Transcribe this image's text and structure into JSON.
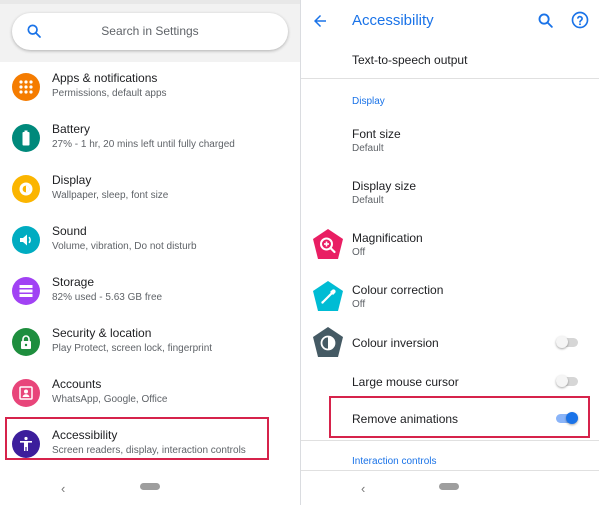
{
  "left_panel": {
    "search_placeholder": "Search in Settings",
    "items": [
      {
        "title": "Apps & notifications",
        "subtitle": "Permissions, default apps",
        "icon": "apps-grid-icon",
        "color": "#f57c00"
      },
      {
        "title": "Battery",
        "subtitle": "27% - 1 hr, 20 mins left until fully charged",
        "icon": "battery-icon",
        "color": "#00897b"
      },
      {
        "title": "Display",
        "subtitle": "Wallpaper, sleep, font size",
        "icon": "brightness-icon",
        "color": "#fbb500"
      },
      {
        "title": "Sound",
        "subtitle": "Volume, vibration, Do not disturb",
        "icon": "volume-icon",
        "color": "#00acc1"
      },
      {
        "title": "Storage",
        "subtitle": "82% used - 5.63 GB free",
        "icon": "storage-icon",
        "color": "#a142f4"
      },
      {
        "title": "Security & location",
        "subtitle": "Play Protect, screen lock, fingerprint",
        "icon": "lock-icon",
        "color": "#1e8e3e"
      },
      {
        "title": "Accounts",
        "subtitle": "WhatsApp, Google, Office",
        "icon": "account-icon",
        "color": "#e8457a"
      },
      {
        "title": "Accessibility",
        "subtitle": "Screen readers, display, interaction controls",
        "icon": "accessibility-icon",
        "color": "#3c1e9c"
      }
    ],
    "nav": {
      "back_glyph": "‹"
    }
  },
  "right_panel": {
    "title": "Accessibility",
    "rows": {
      "tts": {
        "title": "Text-to-speech output"
      },
      "display_section": "Display",
      "font_size": {
        "title": "Font size",
        "subtitle": "Default"
      },
      "display_size": {
        "title": "Display size",
        "subtitle": "Default"
      },
      "magnification": {
        "title": "Magnification",
        "subtitle": "Off",
        "color": "#e91e63"
      },
      "colour_correction": {
        "title": "Colour correction",
        "subtitle": "Off",
        "color": "#00bcd4"
      },
      "colour_inversion": {
        "title": "Colour inversion",
        "enabled": false,
        "color": "#455a64"
      },
      "large_mouse_cursor": {
        "title": "Large mouse cursor",
        "enabled": false
      },
      "remove_animations": {
        "title": "Remove animations",
        "enabled": true
      },
      "interaction_section": "Interaction controls"
    },
    "nav": {
      "back_glyph": "‹"
    }
  },
  "colors": {
    "accent": "#1a73e8",
    "highlight": "#d6234b"
  }
}
